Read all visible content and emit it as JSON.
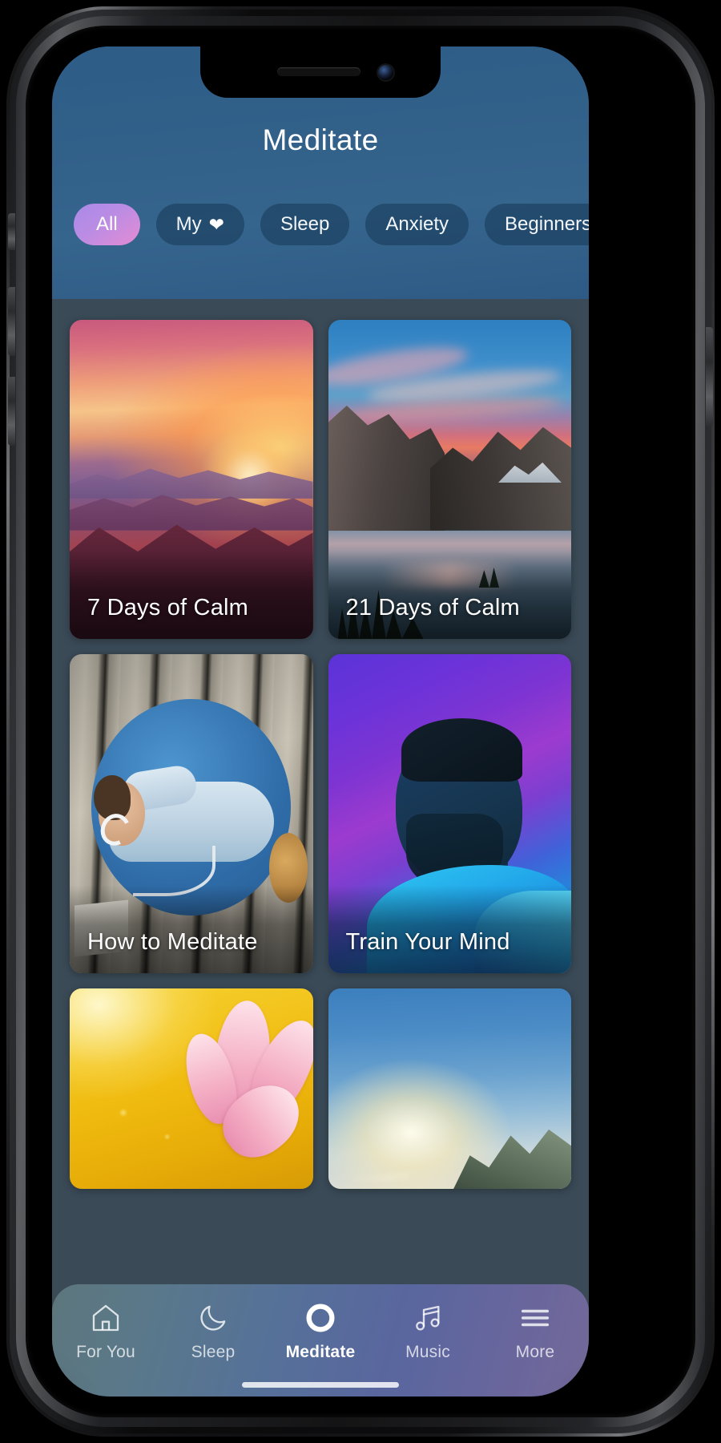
{
  "app": {
    "header": {
      "title": "Meditate"
    },
    "filters": [
      {
        "label": "All",
        "icon": null,
        "active": true
      },
      {
        "label": "My",
        "icon": "heart-icon",
        "active": false
      },
      {
        "label": "Sleep",
        "icon": null,
        "active": false
      },
      {
        "label": "Anxiety",
        "icon": null,
        "active": false
      },
      {
        "label": "Beginners",
        "icon": null,
        "active": false
      }
    ],
    "cards": [
      {
        "title": "7 Days of Calm",
        "art": "sunset-mountains"
      },
      {
        "title": "21 Days of Calm",
        "art": "lake-sunset"
      },
      {
        "title": "How to Meditate",
        "art": "man-on-deck"
      },
      {
        "title": "Train Your Mind",
        "art": "portrait-purple"
      },
      {
        "title": "",
        "art": "lotus-flower"
      },
      {
        "title": "",
        "art": "sun-sky"
      }
    ],
    "tabbar": [
      {
        "label": "For You",
        "icon": "home-icon",
        "active": false
      },
      {
        "label": "Sleep",
        "icon": "moon-icon",
        "active": false
      },
      {
        "label": "Meditate",
        "icon": "circle-icon",
        "active": true
      },
      {
        "label": "Music",
        "icon": "music-note-icon",
        "active": false
      },
      {
        "label": "More",
        "icon": "hamburger-icon",
        "active": false
      }
    ],
    "colors": {
      "header_bg": "#316089",
      "chip_inactive_bg": "#11304c",
      "chip_active_start": "#a98ae8",
      "chip_active_end": "#e58bd2",
      "content_bg": "#3a4a57",
      "tab_active_text": "#ffffff",
      "tab_inactive_text": "#bfc9d4"
    }
  }
}
